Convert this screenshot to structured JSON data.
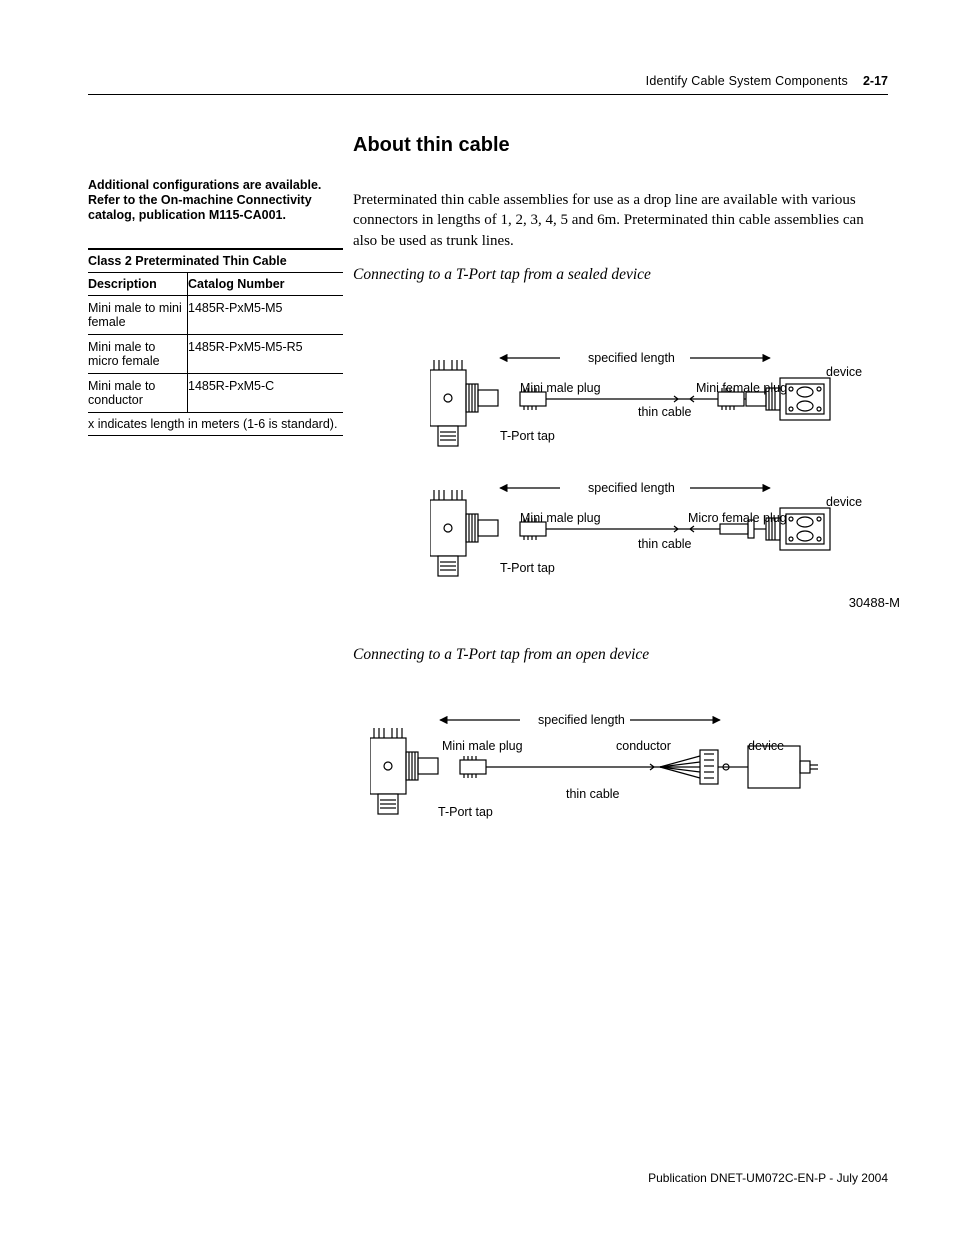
{
  "header": {
    "title": "Identify Cable System Components",
    "page": "2-17"
  },
  "title": "About thin cable",
  "body": "Preterminated thin cable assemblies for use as a drop line are available with various connectors in lengths of 1, 2, 3, 4, 5 and 6m. Preterminated thin cable assemblies can also be used as trunk lines.",
  "sidenote": "Additional configurations are available. Refer to the On-machine Connectivity catalog, publication M115-CA001.",
  "table": {
    "title": "Class 2 Preterminated Thin Cable",
    "head": {
      "c1": "Description",
      "c2": "Catalog Number"
    },
    "rows": [
      {
        "c1": "Mini male to mini female",
        "c2": "1485R-PxM5-M5"
      },
      {
        "c1": "Mini male to micro female",
        "c2": "1485R-PxM5-M5-R5"
      },
      {
        "c1": "Mini male to conductor",
        "c2": "1485R-PxM5-C"
      }
    ],
    "foot": "x indicates length in meters (1-6 is standard)."
  },
  "subhead1": "Connecting to a T-Port tap from a sealed device",
  "subhead2": "Connecting to a T-Port tap from an open device",
  "fig1": {
    "labels": {
      "spec_len": "specified length",
      "mini_male": "Mini male plug",
      "mini_female": "Mini female plug",
      "micro_female": "Micro female plug",
      "thin_cable": "thin cable",
      "tport": "T-Port tap",
      "device": "device"
    },
    "caption": "30488-M"
  },
  "fig2": {
    "labels": {
      "spec_len": "specified length",
      "mini_male": "Mini male plug",
      "conductor": "conductor",
      "thin_cable": "thin cable",
      "tport": "T-Port tap",
      "device": "device"
    }
  },
  "footer": "Publication DNET-UM072C-EN-P - July 2004"
}
